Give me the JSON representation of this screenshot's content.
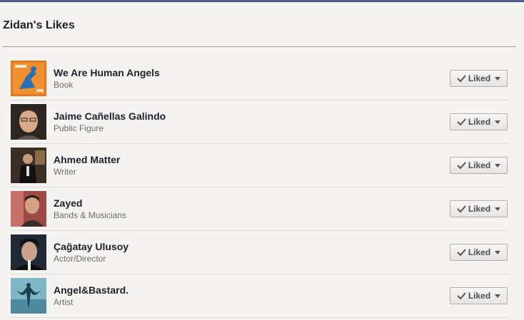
{
  "page": {
    "title": "Zidan's Likes"
  },
  "likes": [
    {
      "name": "We Are Human Angels",
      "category": "Book",
      "button": "Liked"
    },
    {
      "name": "Jaime Cañellas Galindo",
      "category": "Public Figure",
      "button": "Liked"
    },
    {
      "name": "Ahmed Matter",
      "category": "Writer",
      "button": "Liked"
    },
    {
      "name": "Zayed",
      "category": "Bands & Musicians",
      "button": "Liked"
    },
    {
      "name": "Çağatay Ulusoy",
      "category": "Actor/Director",
      "button": "Liked"
    },
    {
      "name": "Angel&Bastard.",
      "category": "Artist",
      "button": "Liked"
    }
  ],
  "colors": {
    "top_bar": "#4f5b93",
    "accent_orange": "#e8771e"
  }
}
